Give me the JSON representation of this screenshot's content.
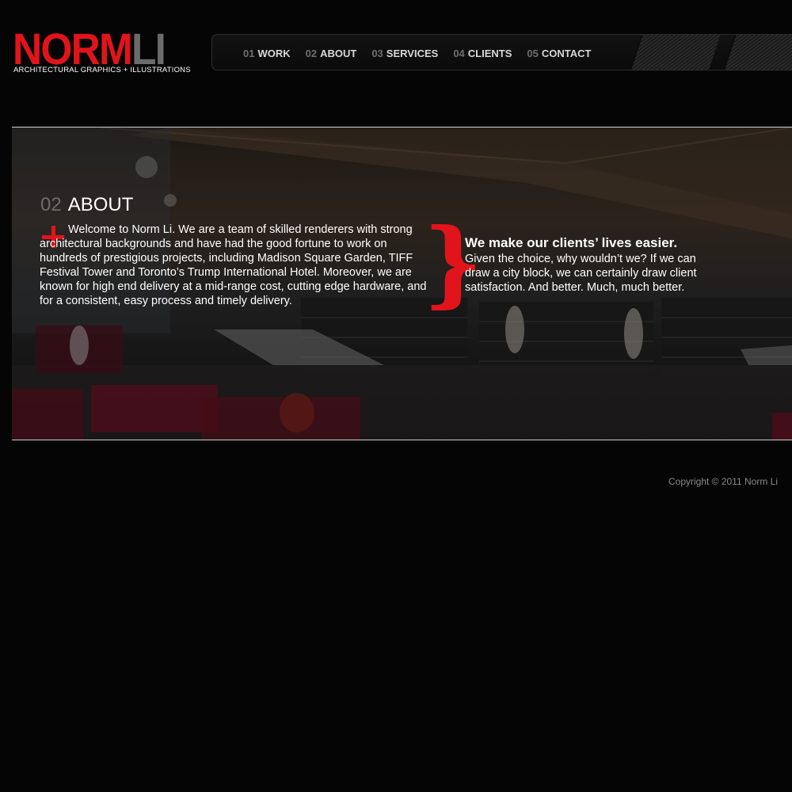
{
  "brand": {
    "logo_norm": "NORM",
    "logo_li": "LI",
    "tagline": "ARCHITECTURAL GRAPHICS + ILLUSTRATIONS",
    "accent_color": "#e1141b"
  },
  "nav": {
    "items": [
      {
        "num": "01",
        "label": "WORK"
      },
      {
        "num": "02",
        "label": "ABOUT"
      },
      {
        "num": "03",
        "label": "SERVICES"
      },
      {
        "num": "04",
        "label": "CLIENTS"
      },
      {
        "num": "05",
        "label": "CONTACT"
      }
    ]
  },
  "about": {
    "num": "02",
    "title": "ABOUT",
    "body": "Welcome to Norm Li. We are a team of skilled renderers with strong architectural backgrounds and have had the good fortune to work on hundreds of prestigious projects, including Madison Square Garden, TIFF Festival Tower and Toronto’s Trump International Hotel. Moreover, we are known for high end delivery at a mid-range cost, cutting edge hardware, and for a consistent, easy process and timely delivery.",
    "plus_icon": "plus-icon",
    "brace_icon": "brace-icon"
  },
  "pitch": {
    "heading": "We make our clients’ lives easier.",
    "body": "Given the choice, why wouldn’t we? If we can draw a city block, we can certainly draw client satisfaction. And better. Much, much better."
  },
  "footer": {
    "copyright": "Copyright © 2011 Norm Li"
  }
}
